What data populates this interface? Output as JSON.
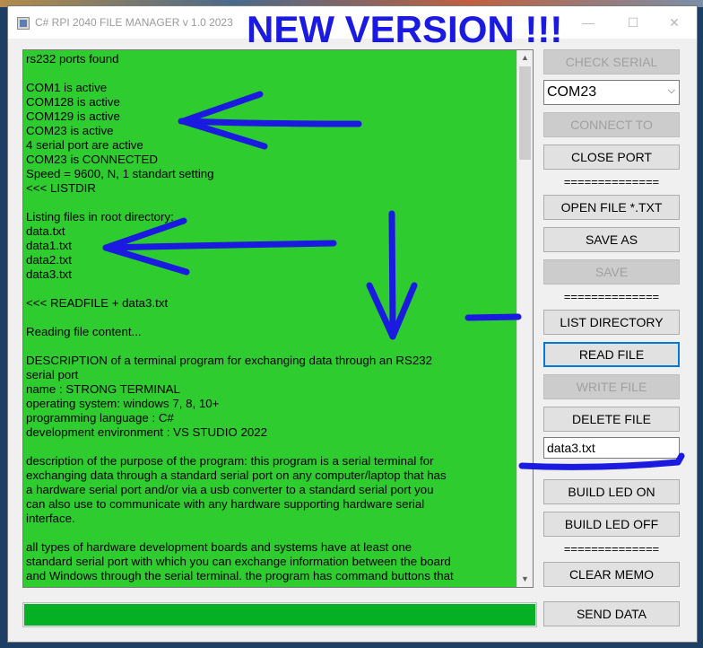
{
  "window": {
    "title": "C# RPI 2040 FILE MANAGER v 1.0 2023",
    "headline": "NEW VERSION !!!",
    "min_glyph": "—",
    "max_glyph": "☐",
    "close_glyph": "✕"
  },
  "memo": {
    "lines": [
      "rs232 ports found",
      "",
      "COM1 is active",
      "COM128 is active",
      "COM129 is active",
      "COM23 is active",
      "4 serial port are active",
      "COM23 is CONNECTED",
      "Speed = 9600, N, 1 standart setting",
      "<<< LISTDIR",
      "",
      "Listing files in root directory:",
      "data.txt",
      "data1.txt",
      "data2.txt",
      "data3.txt",
      "",
      "<<< READFILE + data3.txt",
      "",
      "Reading file content...",
      "",
      "DESCRIPTION of a terminal program for exchanging data through an RS232",
      "serial port",
      "name : STRONG TERMINAL",
      "operating system: windows 7, 8, 10+",
      "programming language : C#",
      "development environment : VS STUDIO 2022",
      "",
      "description of the purpose of the program: this program is a serial terminal for",
      "exchanging data through a standard serial port on any computer/laptop that has",
      "a hardware serial port and/or via a usb converter to a standard serial port you",
      "can also use to communicate with any hardware supporting hardware serial",
      "interface.",
      "",
      "all types of hardware development boards and systems have at least one",
      "standard serial port with which you can exchange information between the board",
      "and Windows through the serial terminal. the program has command buttons that"
    ]
  },
  "scrollbar": {
    "up_glyph": "▲",
    "down_glyph": "▼"
  },
  "progress": {
    "value_fraction": 1.0
  },
  "controls": {
    "check_serial": "CHECK SERIAL",
    "port_select": "COM23",
    "port_select_arrow": "⌵",
    "connect_to": "CONNECT TO",
    "close_port": "CLOSE PORT",
    "separator": "==============",
    "open_file": "OPEN FILE *.TXT",
    "save_as": "SAVE AS",
    "save": "SAVE",
    "list_directory": "LIST DIRECTORY",
    "read_file": "READ FILE",
    "write_file": "WRITE FILE",
    "delete_file": "DELETE FILE",
    "filename_value": "data3.txt",
    "build_led_on": "BUILD LED ON",
    "build_led_off": "BUILD LED OFF",
    "clear_memo": "CLEAR MEMO",
    "send_data": "SEND DATA"
  },
  "colors": {
    "memo_background": "#2ecc2e",
    "progress_fill": "#06b025",
    "annotation_ink": "#1a1ae0",
    "focus_border": "#0078d7"
  }
}
